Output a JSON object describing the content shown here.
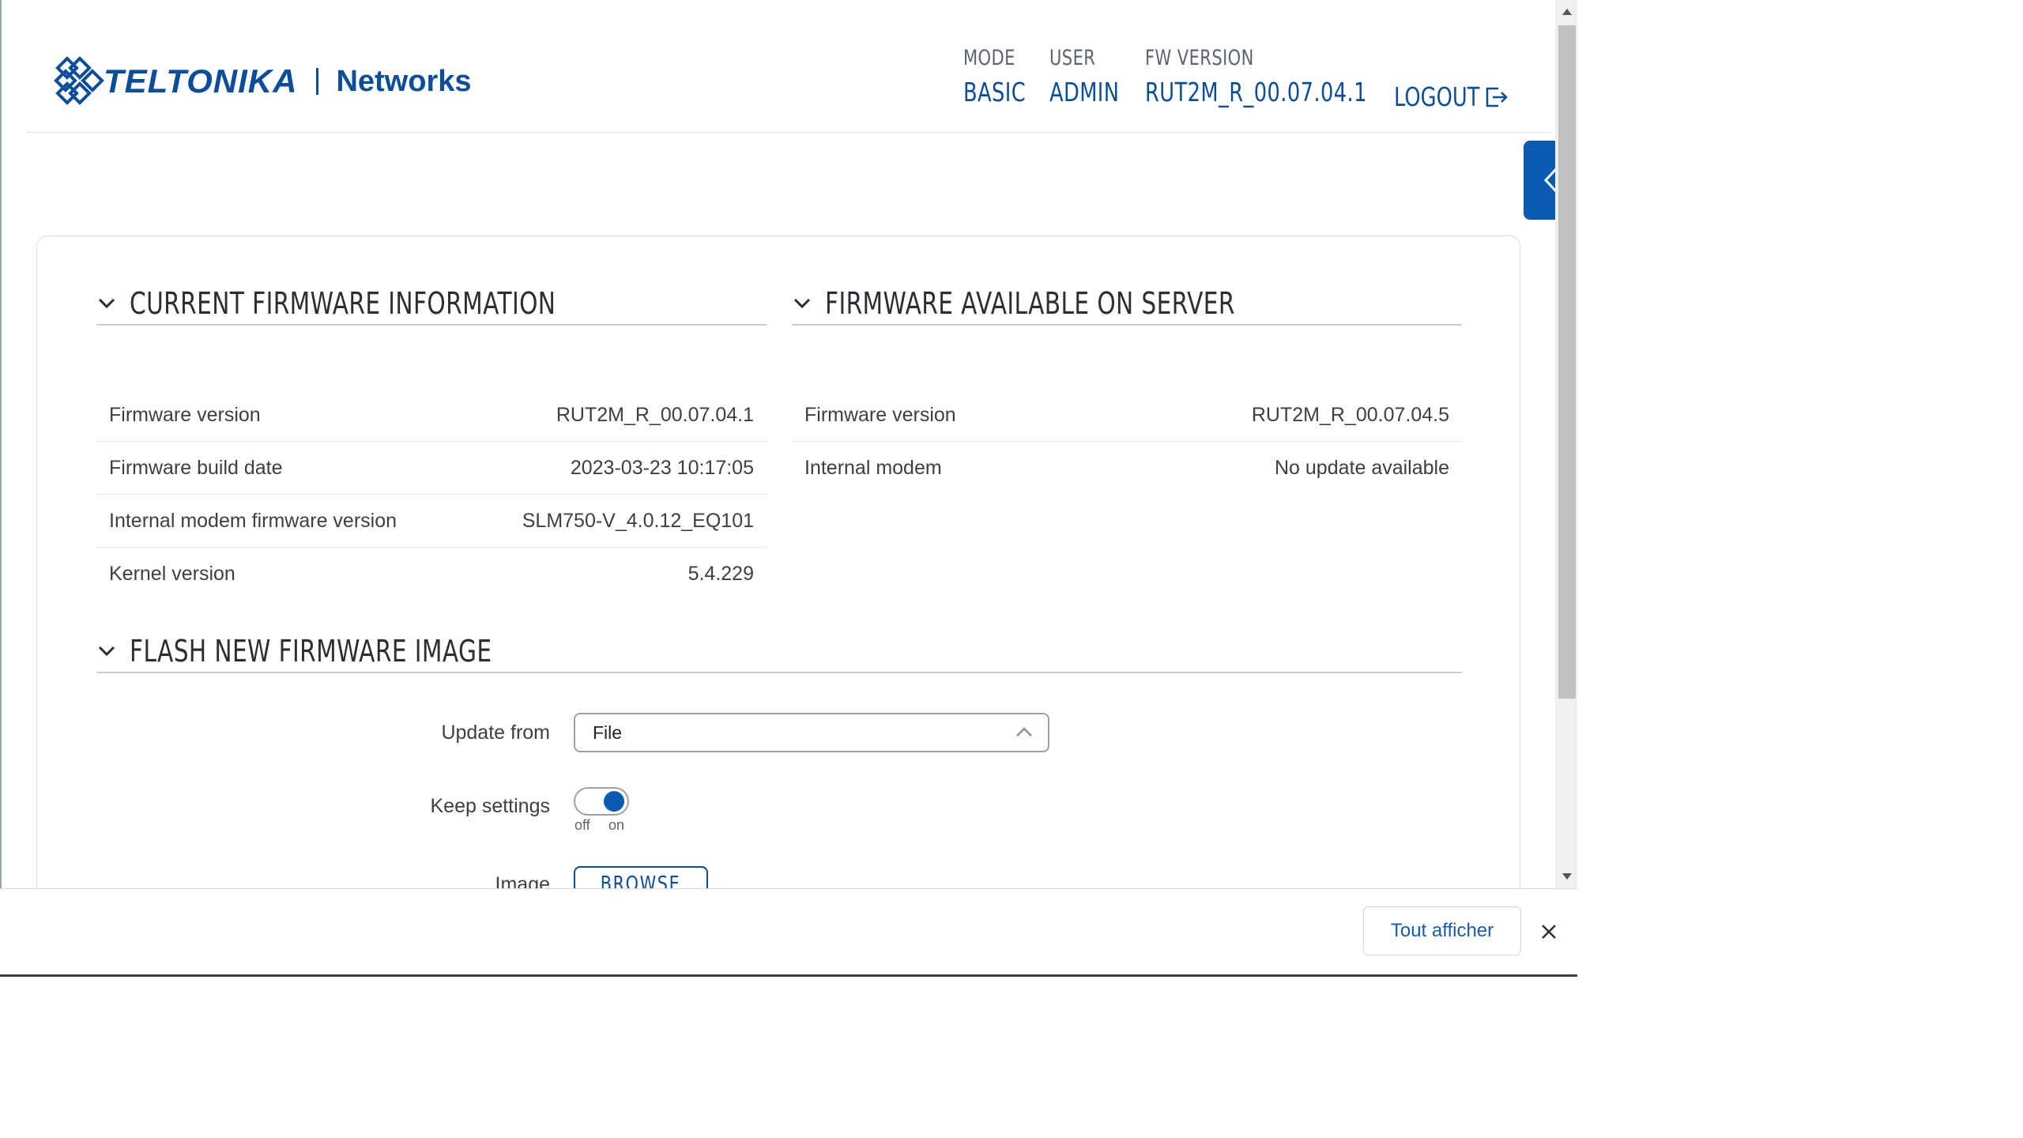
{
  "header": {
    "logo_text": "TELTONIKA",
    "logo_networks": "Networks",
    "mode_label": "MODE",
    "mode_value": "BASIC",
    "user_label": "USER",
    "user_value": "ADMIN",
    "fw_label": "FW VERSION",
    "fw_value": "RUT2M_R_00.07.04.1",
    "logout_label": "LOGOUT"
  },
  "sections": {
    "current_title": "CURRENT FIRMWARE INFORMATION",
    "server_title": "FIRMWARE AVAILABLE ON SERVER",
    "flash_title": "FLASH NEW FIRMWARE IMAGE"
  },
  "current_firmware": [
    {
      "label": "Firmware version",
      "value": "RUT2M_R_00.07.04.1"
    },
    {
      "label": "Firmware build date",
      "value": "2023-03-23 10:17:05"
    },
    {
      "label": "Internal modem firmware version",
      "value": "SLM750-V_4.0.12_EQ101"
    },
    {
      "label": "Kernel version",
      "value": "5.4.229"
    }
  ],
  "server_firmware": [
    {
      "label": "Firmware version",
      "value": "RUT2M_R_00.07.04.5"
    },
    {
      "label": "Internal modem",
      "value": "No update available"
    }
  ],
  "flash": {
    "update_from_label": "Update from",
    "update_from_value": "File",
    "keep_settings_label": "Keep settings",
    "toggle_off": "off",
    "toggle_on": "on",
    "keep_settings_state": "on",
    "image_label": "Image",
    "browse_label": "BROWSE"
  },
  "download_bar": {
    "show_all_label": "Tout afficher"
  },
  "colors": {
    "brand": "#0a4d9a",
    "accent": "#0a5bb4"
  }
}
